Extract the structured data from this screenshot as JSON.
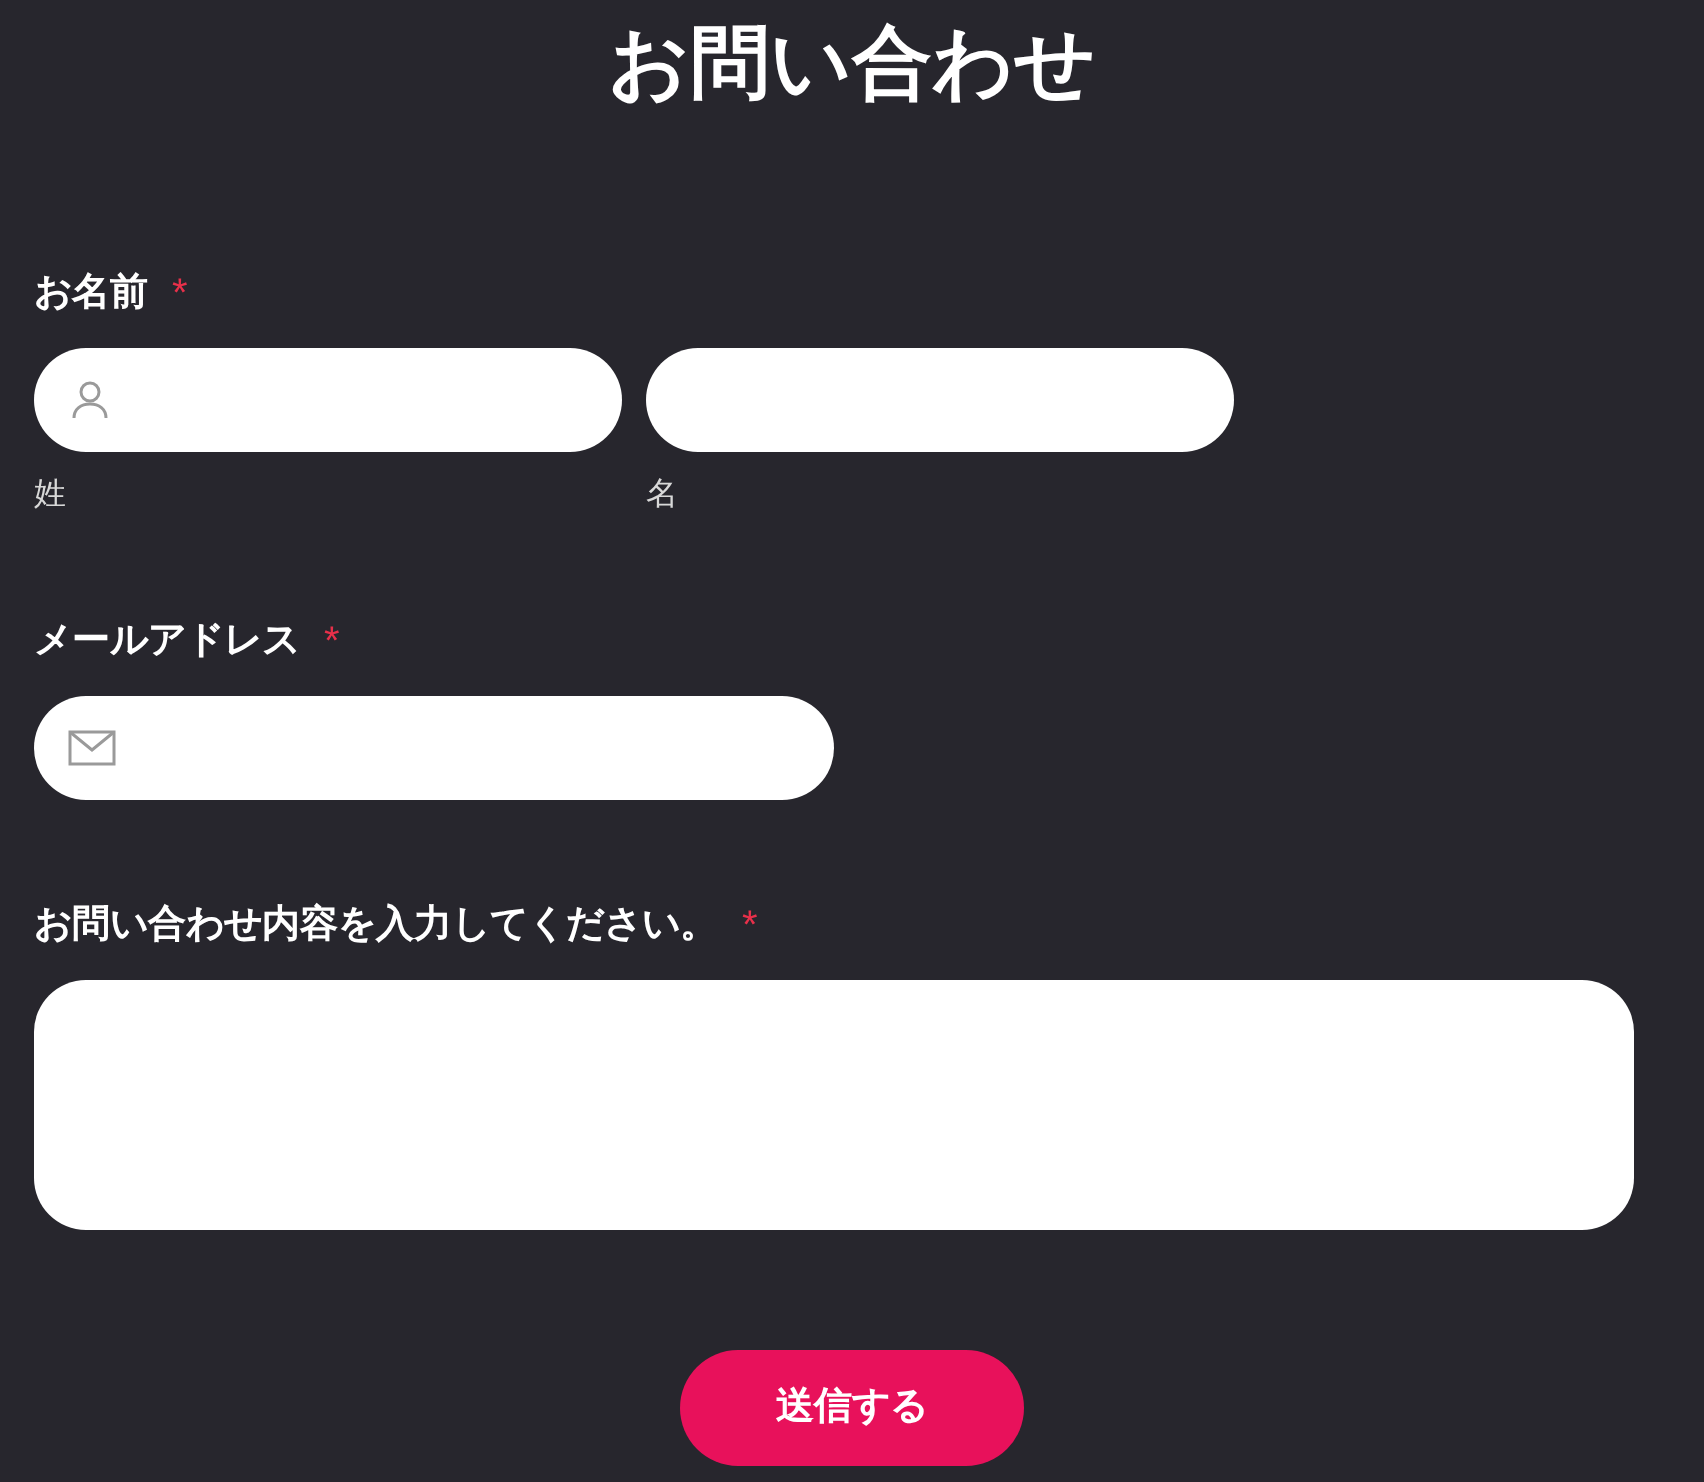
{
  "title": "お問い合わせ",
  "fields": [
    {
      "kind": "name",
      "label": "お名前",
      "required_mark": "*",
      "sublabels": [
        "姓",
        "名"
      ]
    },
    {
      "kind": "email",
      "label": "メールアドレス",
      "required_mark": "*"
    },
    {
      "kind": "message",
      "label": "お問い合わせ内容を入力してください。",
      "required_mark": "*"
    }
  ],
  "submit": "送信する"
}
